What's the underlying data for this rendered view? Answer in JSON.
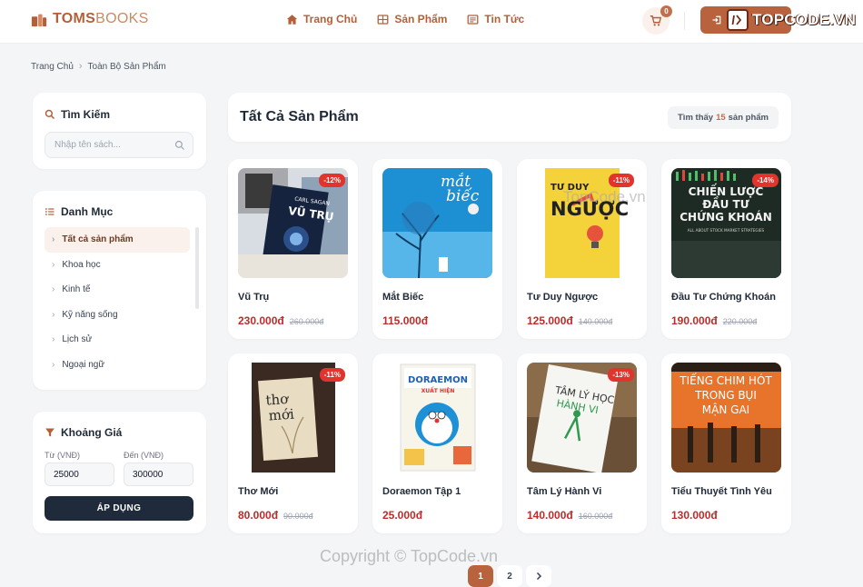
{
  "header": {
    "logo_bold": "TOMS",
    "logo_light": "BOOKS",
    "nav": [
      {
        "label": "Trang Chủ",
        "icon": "home-icon"
      },
      {
        "label": "Sản Phẩm",
        "icon": "grid-icon"
      },
      {
        "label": "Tin Tức",
        "icon": "newspaper-icon"
      }
    ],
    "cart_count": "0"
  },
  "watermark": {
    "top": "TOPCODE.VN",
    "middle": "TopCode.vn",
    "bottom": "Copyright © TopCode.vn"
  },
  "breadcrumb": {
    "home": "Trang Chủ",
    "current": "Toàn Bộ Sản Phẩm"
  },
  "sidebar": {
    "search": {
      "title": "Tìm Kiếm",
      "placeholder": "Nhập tên sách..."
    },
    "categories": {
      "title": "Danh Mục",
      "items": [
        "Tất cả sản phẩm",
        "Khoa học",
        "Kinh tế",
        "Kỹ năng sống",
        "Lịch sử",
        "Ngoại ngữ"
      ],
      "active_index": 0
    },
    "price": {
      "title": "Khoảng Giá",
      "from_label": "Từ (VNĐ)",
      "to_label": "Đến (VNĐ)",
      "from_value": "25000",
      "to_value": "300000",
      "apply_label": "ÁP DỤNG"
    }
  },
  "main": {
    "title": "Tất Cả Sản Phẩm",
    "found_prefix": "Tìm thấy",
    "found_count": "15",
    "found_suffix": "sản phẩm"
  },
  "products": [
    {
      "name": "Vũ Trụ",
      "price": "230.000đ",
      "old_price": "260.000đ",
      "discount": "-12%"
    },
    {
      "name": "Mắt Biếc",
      "price": "115.000đ",
      "old_price": "",
      "discount": ""
    },
    {
      "name": "Tư Duy Ngược",
      "price": "125.000đ",
      "old_price": "140.000đ",
      "discount": "-11%"
    },
    {
      "name": "Đầu Tư Chứng Khoán",
      "price": "190.000đ",
      "old_price": "220.000đ",
      "discount": "-14%"
    },
    {
      "name": "Thơ Mới",
      "price": "80.000đ",
      "old_price": "90.000đ",
      "discount": "-11%"
    },
    {
      "name": "Doraemon Tập 1",
      "price": "25.000đ",
      "old_price": "",
      "discount": ""
    },
    {
      "name": "Tâm Lý Hành Vi",
      "price": "140.000đ",
      "old_price": "160.000đ",
      "discount": "-13%"
    },
    {
      "name": "Tiểu Thuyết Tình Yêu",
      "price": "130.000đ",
      "old_price": "",
      "discount": ""
    }
  ],
  "covers": [
    {
      "lines": [
        "CARL SAGAN",
        "VŨ TRỤ"
      ]
    },
    {
      "lines": [
        "mắt",
        "biếc"
      ]
    },
    {
      "lines": [
        "TƯ DUY",
        "NGƯỢC"
      ]
    },
    {
      "lines": [
        "CHIẾN LƯỢC",
        "ĐẦU TƯ",
        "CHỨNG KHOÁN",
        "ALL ABOUT STOCK MARKET STRATEGIES"
      ]
    },
    {
      "lines": [
        "thơ",
        "mới"
      ]
    },
    {
      "lines": [
        "DORAEMON",
        "XUẤT HIỆN"
      ]
    },
    {
      "lines": [
        "TÂM LÝ HỌC",
        "HÀNH VI"
      ]
    },
    {
      "lines": [
        "TIẾNG CHIM HÓT",
        "TRONG BỤI",
        "MẬN GAI"
      ]
    }
  ],
  "pagination": {
    "pages": [
      "1",
      "2"
    ],
    "active": "1",
    "next_icon": "chevron-right-icon"
  },
  "colors": {
    "brand": "#b8633e",
    "price": "#c02a2a",
    "discount": "#e0342d",
    "dark_button": "#1f2a3a"
  }
}
